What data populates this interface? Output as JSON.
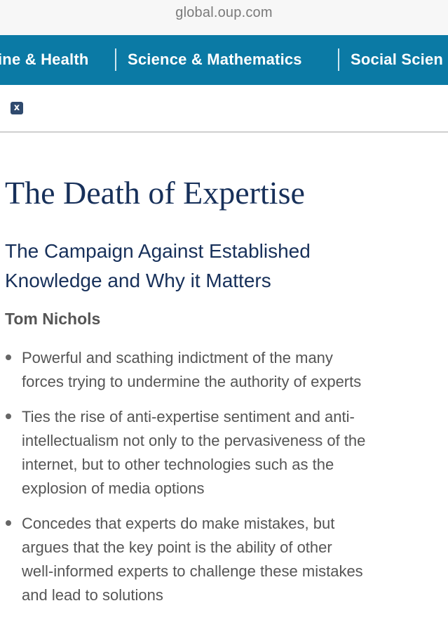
{
  "browser": {
    "url": "global.oup.com"
  },
  "nav": {
    "items": [
      "ine & Health",
      "Science & Mathematics",
      "Social Scien"
    ]
  },
  "toolbar": {
    "close_label": "x"
  },
  "book": {
    "title": "The Death of Expertise",
    "subtitle_lines": [
      "The Campaign Against Established",
      "Knowledge and Why it Matters"
    ],
    "author": "Tom Nichols",
    "bullets": [
      {
        "lines": [
          "Powerful and scathing indictment of the many",
          "forces trying to undermine the authority of experts"
        ]
      },
      {
        "lines": [
          "Ties the rise of anti-expertise sentiment and anti-",
          "intellectualism not only to the pervasiveness of the",
          "internet, but to other technologies such as the",
          "explosion of media options"
        ]
      },
      {
        "lines": [
          "Concedes that experts do make mistakes, but",
          "argues that the key point is the ability of other",
          "well-informed experts to challenge these mistakes",
          "and lead to solutions"
        ]
      }
    ]
  },
  "colors": {
    "nav_background": "#0b7aa5",
    "title": "#17305a",
    "body_text": "#555555"
  }
}
